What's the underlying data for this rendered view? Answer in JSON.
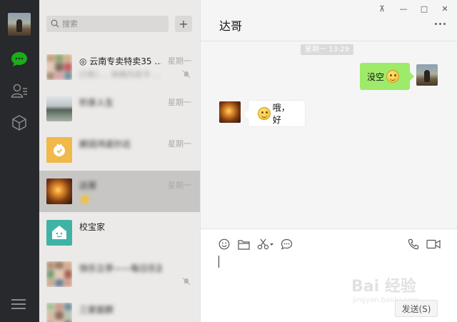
{
  "window": {
    "pin_label": "⊼",
    "minimize_label": "—",
    "maximize_label": "□",
    "close_label": "✕"
  },
  "sidebar": {
    "nav": [
      "chat-icon",
      "contacts-icon",
      "favorites-icon"
    ],
    "active_color": "#1aad19"
  },
  "search": {
    "placeholder": "搜索",
    "add_label": "+"
  },
  "conversations": [
    {
      "name": "◎ 云南专卖特卖35 …",
      "preview": "[5条] … 钟爽内衣今 …",
      "time": "星期一",
      "muted": true
    },
    {
      "name": "钓享人生",
      "preview": "",
      "time": "星期一",
      "muted": false
    },
    {
      "name": "朗润鸿诺尔达",
      "preview": "",
      "time": "星期一",
      "muted": false
    },
    {
      "name": "达哥",
      "preview": "",
      "time": "星期一",
      "muted": false
    },
    {
      "name": "校宝家",
      "preview": "",
      "time": "",
      "muted": false
    },
    {
      "name": "快乐立亭——每日乐游群",
      "preview": "",
      "time": "",
      "muted": true
    },
    {
      "name": "三家庭群",
      "preview": "",
      "time": "",
      "muted": false
    }
  ],
  "chat": {
    "title": "达哥",
    "more_label": "···",
    "time_separator": "星期一 13:29",
    "messages": [
      {
        "from": "me",
        "text": "没空"
      },
      {
        "from": "other",
        "text": "哦，好"
      }
    ]
  },
  "composer": {
    "tools": [
      "emoji-icon",
      "folder-icon",
      "scissors-icon",
      "chat-bubble-icon"
    ],
    "right_tools": [
      "phone-icon",
      "video-icon"
    ],
    "send_label": "发送(S)"
  },
  "watermark": {
    "main": "Bai 经验",
    "sub": "jingyan.baidu.com"
  }
}
